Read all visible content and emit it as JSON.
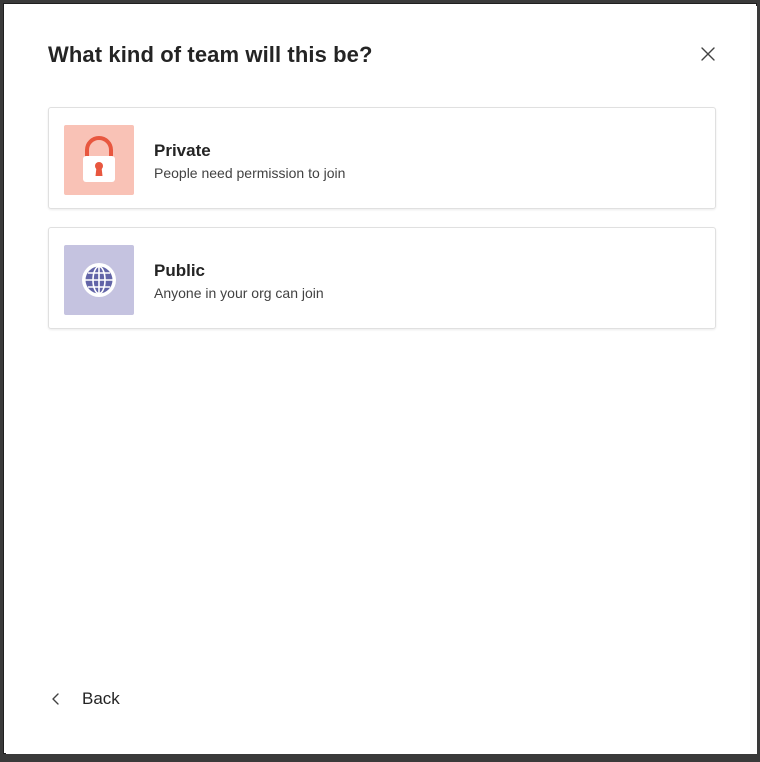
{
  "dialog": {
    "title": "What kind of team will this be?",
    "close_icon": "close-icon"
  },
  "options": [
    {
      "title": "Private",
      "description": "People need permission to join",
      "icon": "lock-icon",
      "icon_bg": "#f9c2b6",
      "icon_color": "#e8573f"
    },
    {
      "title": "Public",
      "description": "Anyone in your org can join",
      "icon": "globe-icon",
      "icon_bg": "#c5c3e0",
      "icon_color": "#6264a7"
    }
  ],
  "footer": {
    "back_label": "Back",
    "back_icon": "chevron-left-icon"
  }
}
